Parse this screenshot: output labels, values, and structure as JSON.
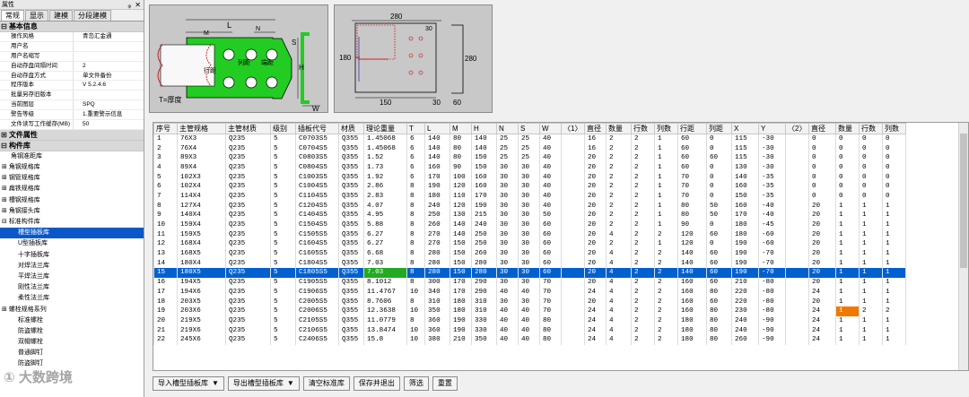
{
  "panel": {
    "title": "属性",
    "pin": "ᵩ",
    "close": "✕"
  },
  "tabs": [
    "常规",
    "显示",
    "建模",
    "分段建模"
  ],
  "sections": {
    "basic": "基本信息",
    "file": "文件属性",
    "lib": "构件库"
  },
  "basic_props": [
    {
      "k": "操作风格",
      "v": "青岛汇金通"
    },
    {
      "k": "用户名",
      "v": ""
    },
    {
      "k": "用户名缩写",
      "v": ""
    },
    {
      "k": "自动存盘间隔时间",
      "v": "2"
    },
    {
      "k": "自动存盘方式",
      "v": "单文件备份"
    },
    {
      "k": "程序版本",
      "v": "V 5.2.4.6"
    },
    {
      "k": "批量另存旧版本",
      "v": ""
    },
    {
      "k": "当前图层",
      "v": "SPQ"
    },
    {
      "k": "警告等级",
      "v": "1.重要警示信息"
    },
    {
      "k": "文件读写工作缓存(MB)",
      "v": "50"
    }
  ],
  "lib_items": [
    {
      "label": "角钢准距库",
      "indent": 12,
      "exp": ""
    },
    {
      "label": "角钢规格库",
      "indent": 2,
      "exp": "⊞ "
    },
    {
      "label": "钢管规格库",
      "indent": 2,
      "exp": "⊞ "
    },
    {
      "label": "扁铁规格库",
      "indent": 2,
      "exp": "⊞ "
    },
    {
      "label": "槽钢规格库",
      "indent": 2,
      "exp": "⊞ "
    },
    {
      "label": "角钢接头库",
      "indent": 2,
      "exp": "⊞ "
    },
    {
      "label": "标准构件库",
      "indent": 2,
      "exp": "⊟ "
    },
    {
      "label": "槽型插板库",
      "indent": 20,
      "exp": "",
      "sel": true
    },
    {
      "label": "U型插板库",
      "indent": 20,
      "exp": ""
    },
    {
      "label": "十字插板库",
      "indent": 20,
      "exp": ""
    },
    {
      "label": "对焊法兰库",
      "indent": 20,
      "exp": ""
    },
    {
      "label": "平焊法兰库",
      "indent": 20,
      "exp": ""
    },
    {
      "label": "刚性法兰库",
      "indent": 20,
      "exp": ""
    },
    {
      "label": "柔性法兰库",
      "indent": 20,
      "exp": ""
    },
    {
      "label": "螺栓规格系列",
      "indent": 2,
      "exp": "⊞ "
    },
    {
      "label": "标准螺栓",
      "indent": 20,
      "exp": ""
    },
    {
      "label": "防盗螺栓",
      "indent": 20,
      "exp": ""
    },
    {
      "label": "双帽螺栓",
      "indent": 20,
      "exp": ""
    },
    {
      "label": "普通脚钉",
      "indent": 20,
      "exp": ""
    },
    {
      "label": "防盗脚钉",
      "indent": 20,
      "exp": ""
    }
  ],
  "diagram1": {
    "L": "L",
    "M": "M",
    "N": "N",
    "H": "H",
    "S": "S",
    "W": "W",
    "lj": "列距",
    "bj": "端距",
    "hj": "行距",
    "T": "T=厚度"
  },
  "diagram2": {
    "w": "280",
    "h": "280",
    "l": "180",
    "r": "30",
    "b1": "150",
    "b2": "30",
    "b3": "60"
  },
  "columns": [
    "序号",
    "主管规格",
    "主管材质",
    "级别",
    "插板代号",
    "材质",
    "理论重量",
    "T",
    "L",
    "M",
    "H",
    "N",
    "S",
    "W",
    "〈1〉",
    "直径",
    "数量",
    "行数",
    "列数",
    "行距",
    "列距",
    "X",
    "Y",
    "〈2〉",
    "直径",
    "数量",
    "行数",
    "列数"
  ],
  "rows": [
    [
      "1",
      "76X3",
      "Q235",
      "5",
      "C0703S5",
      "Q355",
      "1.45068",
      "6",
      "140",
      "80",
      "140",
      "25",
      "25",
      "40",
      "",
      "16",
      "2",
      "2",
      "1",
      "60",
      "0",
      "115",
      "-30",
      "",
      "0",
      "0",
      "0",
      "0"
    ],
    [
      "2",
      "76X4",
      "Q235",
      "5",
      "C0704S5",
      "Q355",
      "1.45068",
      "6",
      "140",
      "80",
      "140",
      "25",
      "25",
      "40",
      "",
      "16",
      "2",
      "2",
      "1",
      "60",
      "0",
      "115",
      "-30",
      "",
      "0",
      "0",
      "0",
      "0"
    ],
    [
      "3",
      "89X3",
      "Q235",
      "5",
      "C0803S5",
      "Q355",
      "1.52",
      "6",
      "140",
      "80",
      "150",
      "25",
      "25",
      "40",
      "",
      "20",
      "2",
      "2",
      "1",
      "60",
      "60",
      "115",
      "-30",
      "",
      "0",
      "0",
      "0",
      "0"
    ],
    [
      "4",
      "89X4",
      "Q235",
      "5",
      "C0804S5",
      "Q355",
      "1.73",
      "6",
      "160",
      "90",
      "150",
      "30",
      "30",
      "40",
      "",
      "20",
      "2",
      "2",
      "1",
      "60",
      "0",
      "130",
      "-30",
      "",
      "0",
      "0",
      "0",
      "0"
    ],
    [
      "5",
      "102X3",
      "Q235",
      "5",
      "C1003S5",
      "Q355",
      "1.92",
      "6",
      "170",
      "100",
      "160",
      "30",
      "30",
      "40",
      "",
      "20",
      "2",
      "2",
      "1",
      "70",
      "0",
      "140",
      "-35",
      "",
      "0",
      "0",
      "0",
      "0"
    ],
    [
      "6",
      "102X4",
      "Q235",
      "5",
      "C1004S5",
      "Q355",
      "2.86",
      "8",
      "190",
      "120",
      "160",
      "30",
      "30",
      "40",
      "",
      "20",
      "2",
      "2",
      "1",
      "70",
      "0",
      "160",
      "-35",
      "",
      "0",
      "0",
      "0",
      "0"
    ],
    [
      "7",
      "114X4",
      "Q235",
      "5",
      "C1104S5",
      "Q355",
      "2.83",
      "8",
      "180",
      "110",
      "170",
      "30",
      "30",
      "40",
      "",
      "20",
      "2",
      "2",
      "1",
      "70",
      "0",
      "150",
      "-35",
      "",
      "0",
      "0",
      "0",
      "0"
    ],
    [
      "8",
      "127X4",
      "Q235",
      "5",
      "C1204S5",
      "Q355",
      "4.07",
      "8",
      "240",
      "120",
      "190",
      "30",
      "30",
      "40",
      "",
      "20",
      "2",
      "2",
      "1",
      "80",
      "50",
      "160",
      "-40",
      "",
      "20",
      "1",
      "1",
      "1"
    ],
    [
      "9",
      "140X4",
      "Q235",
      "5",
      "C1404S5",
      "Q355",
      "4.95",
      "8",
      "250",
      "130",
      "215",
      "30",
      "30",
      "50",
      "",
      "20",
      "2",
      "2",
      "1",
      "80",
      "50",
      "170",
      "-40",
      "",
      "20",
      "1",
      "1",
      "1"
    ],
    [
      "10",
      "159X4",
      "Q235",
      "5",
      "C1504S5",
      "Q355",
      "5.88",
      "8",
      "260",
      "140",
      "240",
      "30",
      "30",
      "60",
      "",
      "20",
      "2",
      "2",
      "1",
      "90",
      "0",
      "180",
      "-45",
      "",
      "20",
      "1",
      "1",
      "1"
    ],
    [
      "11",
      "159X5",
      "Q235",
      "5",
      "C1505S5",
      "Q355",
      "6.27",
      "8",
      "270",
      "140",
      "250",
      "30",
      "30",
      "60",
      "",
      "20",
      "4",
      "2",
      "2",
      "120",
      "60",
      "180",
      "-60",
      "",
      "20",
      "1",
      "1",
      "1"
    ],
    [
      "12",
      "168X4",
      "Q235",
      "5",
      "C1604S5",
      "Q355",
      "6.27",
      "8",
      "270",
      "150",
      "250",
      "30",
      "30",
      "60",
      "",
      "20",
      "2",
      "2",
      "1",
      "120",
      "0",
      "190",
      "-60",
      "",
      "20",
      "1",
      "1",
      "1"
    ],
    [
      "13",
      "168X5",
      "Q235",
      "5",
      "C1605S5",
      "Q355",
      "6.68",
      "8",
      "280",
      "150",
      "260",
      "30",
      "30",
      "60",
      "",
      "20",
      "4",
      "2",
      "2",
      "140",
      "60",
      "190",
      "-70",
      "",
      "20",
      "1",
      "1",
      "1"
    ],
    [
      "14",
      "180X4",
      "Q235",
      "5",
      "C1804S5",
      "Q355",
      "7.03",
      "8",
      "280",
      "150",
      "280",
      "30",
      "30",
      "60",
      "",
      "20",
      "4",
      "2",
      "2",
      "140",
      "60",
      "190",
      "-70",
      "",
      "20",
      "1",
      "1",
      "1"
    ],
    [
      "15",
      "180X5",
      "Q235",
      "5",
      "C1805S5",
      "Q355",
      "7.03",
      "8",
      "280",
      "150",
      "280",
      "30",
      "30",
      "60",
      "",
      "20",
      "4",
      "2",
      "2",
      "140",
      "60",
      "190",
      "-70",
      "",
      "20",
      "1",
      "1",
      "1"
    ],
    [
      "16",
      "194X5",
      "Q235",
      "5",
      "C1905S5",
      "Q355",
      "8.1012",
      "8",
      "300",
      "170",
      "290",
      "30",
      "30",
      "70",
      "",
      "20",
      "4",
      "2",
      "2",
      "160",
      "60",
      "210",
      "-80",
      "",
      "20",
      "1",
      "1",
      "1"
    ],
    [
      "17",
      "194X6",
      "Q235",
      "5",
      "C1906S5",
      "Q355",
      "11.4767",
      "10",
      "340",
      "170",
      "290",
      "40",
      "40",
      "70",
      "",
      "24",
      "4",
      "2",
      "2",
      "160",
      "80",
      "220",
      "-80",
      "",
      "24",
      "1",
      "1",
      "1"
    ],
    [
      "18",
      "203X5",
      "Q235",
      "5",
      "C2005S5",
      "Q355",
      "8.7606",
      "8",
      "310",
      "180",
      "310",
      "30",
      "30",
      "70",
      "",
      "20",
      "4",
      "2",
      "2",
      "160",
      "60",
      "220",
      "-80",
      "",
      "20",
      "1",
      "1",
      "1"
    ],
    [
      "19",
      "203X6",
      "Q235",
      "5",
      "C2006S5",
      "Q355",
      "12.3638",
      "10",
      "350",
      "180",
      "310",
      "40",
      "40",
      "70",
      "",
      "24",
      "4",
      "2",
      "2",
      "160",
      "80",
      "230",
      "-80",
      "",
      "24",
      "1",
      "2",
      "2"
    ],
    [
      "20",
      "219X5",
      "Q235",
      "5",
      "C2105S5",
      "Q355",
      "11.0779",
      "8",
      "360",
      "190",
      "330",
      "40",
      "40",
      "80",
      "",
      "24",
      "4",
      "2",
      "2",
      "180",
      "80",
      "240",
      "-90",
      "",
      "24",
      "1",
      "1",
      "1"
    ],
    [
      "21",
      "219X6",
      "Q235",
      "5",
      "C2106S5",
      "Q355",
      "13.8474",
      "10",
      "360",
      "190",
      "330",
      "40",
      "40",
      "80",
      "",
      "24",
      "4",
      "2",
      "2",
      "180",
      "80",
      "240",
      "-90",
      "",
      "24",
      "1",
      "1",
      "1"
    ],
    [
      "22",
      "245X6",
      "Q235",
      "5",
      "C2406S5",
      "Q355",
      "15.8",
      "10",
      "380",
      "210",
      "350",
      "40",
      "40",
      "80",
      "",
      "24",
      "4",
      "2",
      "2",
      "180",
      "80",
      "260",
      "-90",
      "",
      "24",
      "1",
      "1",
      "1"
    ]
  ],
  "selected_row": 14,
  "buttons": {
    "import": "导入槽型插板库",
    "export": "导出槽型插板库",
    "clear": "清空标准库",
    "save": "保存并退出",
    "filter": "筛选",
    "reset": "重置",
    "arrow": "▼"
  },
  "watermark": "① 大数跨境",
  "colors": {
    "selection": "#0060d0",
    "weight_hl": "#22aa22",
    "qty_hl": "#f07800",
    "plate_fill": "#22cc22"
  }
}
